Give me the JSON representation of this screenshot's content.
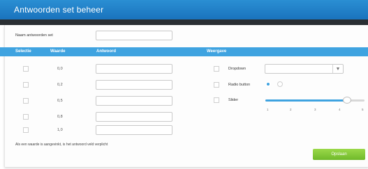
{
  "header": {
    "title": "Antwoorden set beheer"
  },
  "name_field": {
    "label": "Naam antwoorden set",
    "value": ""
  },
  "columns": {
    "selectie": "Selectie",
    "waarde": "Waarde",
    "antwoord": "Antwoord",
    "weergave": "Weergave"
  },
  "rows": [
    {
      "value": "0,0",
      "checked": false
    },
    {
      "value": "0,2",
      "checked": false
    },
    {
      "value": "0,5",
      "checked": false
    },
    {
      "value": "0,8",
      "checked": false
    },
    {
      "value": "1,0",
      "checked": false
    }
  ],
  "display_options": {
    "dropdown": {
      "label": "Dropdown",
      "checked": false
    },
    "radio": {
      "label": "Radio button",
      "checked": false
    },
    "slider": {
      "label": "Slider",
      "checked": false,
      "ticks": [
        "1",
        "2",
        "3",
        "4",
        "5"
      ],
      "value": 4.3
    }
  },
  "note": "Als een waarde is aangevinkt, is het antwoord veld verplicht",
  "save_button": "Opslaan",
  "colors": {
    "header": "#1a73bd",
    "column_bar": "#3fa3e0",
    "save": "#7cc433"
  }
}
